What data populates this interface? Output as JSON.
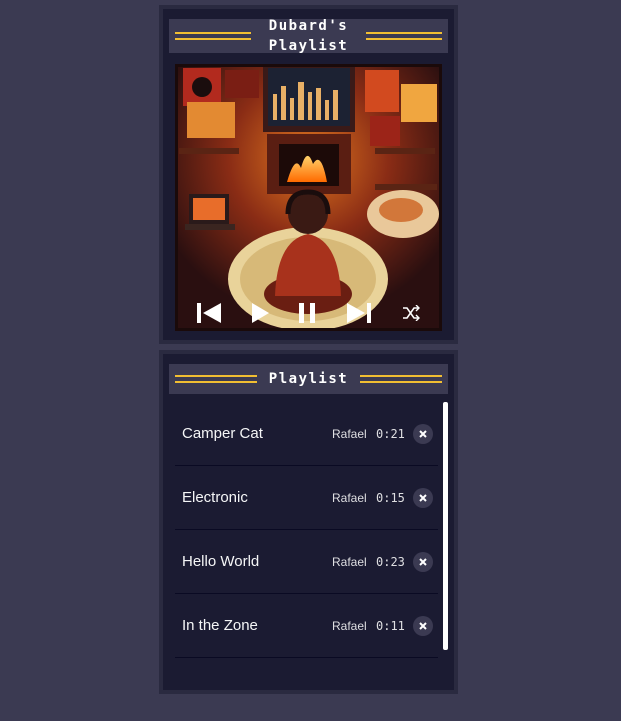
{
  "player": {
    "title_line1": "Dubard's",
    "title_line2": "Playlist",
    "controls": [
      {
        "name": "previous-button",
        "icon": "skip-back-icon"
      },
      {
        "name": "play-button",
        "icon": "play-icon"
      },
      {
        "name": "pause-button",
        "icon": "pause-icon"
      },
      {
        "name": "next-button",
        "icon": "skip-forward-icon"
      },
      {
        "name": "shuffle-button",
        "icon": "shuffle-icon"
      }
    ]
  },
  "playlist": {
    "title": "Playlist",
    "songs": [
      {
        "title": "Camper Cat",
        "artist": "Rafael",
        "duration": "0:21"
      },
      {
        "title": "Electronic",
        "artist": "Rafael",
        "duration": "0:15"
      },
      {
        "title": "Hello World",
        "artist": "Rafael",
        "duration": "0:23"
      },
      {
        "title": "In the Zone",
        "artist": "Rafael",
        "duration": "0:11"
      }
    ]
  },
  "colors": {
    "background": "#3b3a52",
    "panel": "#1b1b32",
    "accent": "#f1be32",
    "text": "#f5f6f7"
  }
}
